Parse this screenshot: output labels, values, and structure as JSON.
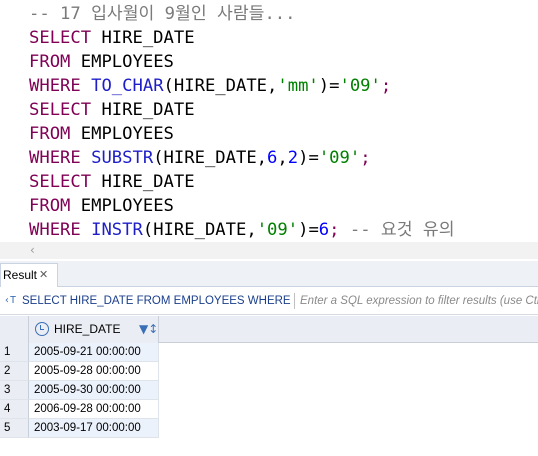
{
  "editor": {
    "lines": [
      [
        {
          "t": "-- 17 입사월이 9월인 사람들...",
          "c": "cm"
        }
      ],
      [
        {
          "t": "SELECT",
          "c": "kw"
        },
        {
          "t": " HIRE_DATE",
          "c": "dl"
        }
      ],
      [
        {
          "t": "FROM",
          "c": "kw"
        },
        {
          "t": " EMPLOYEES",
          "c": "dl"
        }
      ],
      [
        {
          "t": "WHERE",
          "c": "kw"
        },
        {
          "t": " ",
          "c": "dl"
        },
        {
          "t": "TO_CHAR",
          "c": "fn"
        },
        {
          "t": "(HIRE_DATE,",
          "c": "dl"
        },
        {
          "t": "'mm'",
          "c": "str"
        },
        {
          "t": ")=",
          "c": "dl"
        },
        {
          "t": "'09'",
          "c": "str"
        },
        {
          "t": ";",
          "c": "kw"
        }
      ],
      [
        {
          "t": "SELECT",
          "c": "kw"
        },
        {
          "t": " HIRE_DATE",
          "c": "dl"
        }
      ],
      [
        {
          "t": "FROM",
          "c": "kw"
        },
        {
          "t": " EMPLOYEES",
          "c": "dl"
        }
      ],
      [
        {
          "t": "WHERE",
          "c": "kw"
        },
        {
          "t": " ",
          "c": "dl"
        },
        {
          "t": "SUBSTR",
          "c": "fn"
        },
        {
          "t": "(HIRE_DATE,",
          "c": "dl"
        },
        {
          "t": "6",
          "c": "num"
        },
        {
          "t": ",",
          "c": "dl"
        },
        {
          "t": "2",
          "c": "num"
        },
        {
          "t": ")=",
          "c": "dl"
        },
        {
          "t": "'09'",
          "c": "str"
        },
        {
          "t": ";",
          "c": "kw"
        }
      ],
      [
        {
          "t": "SELECT",
          "c": "kw"
        },
        {
          "t": " HIRE_DATE",
          "c": "dl"
        }
      ],
      [
        {
          "t": "FROM",
          "c": "kw"
        },
        {
          "t": " EMPLOYEES",
          "c": "dl"
        }
      ],
      [
        {
          "t": "WHERE",
          "c": "kw"
        },
        {
          "t": " ",
          "c": "dl"
        },
        {
          "t": "INSTR",
          "c": "fn"
        },
        {
          "t": "(HIRE_DATE,",
          "c": "dl"
        },
        {
          "t": "'09'",
          "c": "str"
        },
        {
          "t": ")=",
          "c": "dl"
        },
        {
          "t": "6",
          "c": "num"
        },
        {
          "t": ";",
          "c": "kw"
        },
        {
          "t": " -- 요것 유의",
          "c": "cm"
        }
      ]
    ],
    "scroll_arrow": "‹"
  },
  "results": {
    "tab_label": "Result",
    "tab_close": "✕",
    "query_icon": "‹T",
    "query_text": "SELECT HIRE_DATE FROM EMPLOYEES WHERE IN",
    "filter_placeholder": "Enter a SQL expression to filter results (use Ctrl+Space)",
    "column": {
      "label": "HIRE_DATE",
      "icon": "clock-icon",
      "sort_glyph": "▼↕"
    },
    "rows": [
      {
        "num": "1",
        "value": "2005-09-21 00:00:00"
      },
      {
        "num": "2",
        "value": "2005-09-28 00:00:00"
      },
      {
        "num": "3",
        "value": "2005-09-30 00:00:00"
      },
      {
        "num": "4",
        "value": "2006-09-28 00:00:00"
      },
      {
        "num": "5",
        "value": "2003-09-17 00:00:00"
      }
    ]
  }
}
